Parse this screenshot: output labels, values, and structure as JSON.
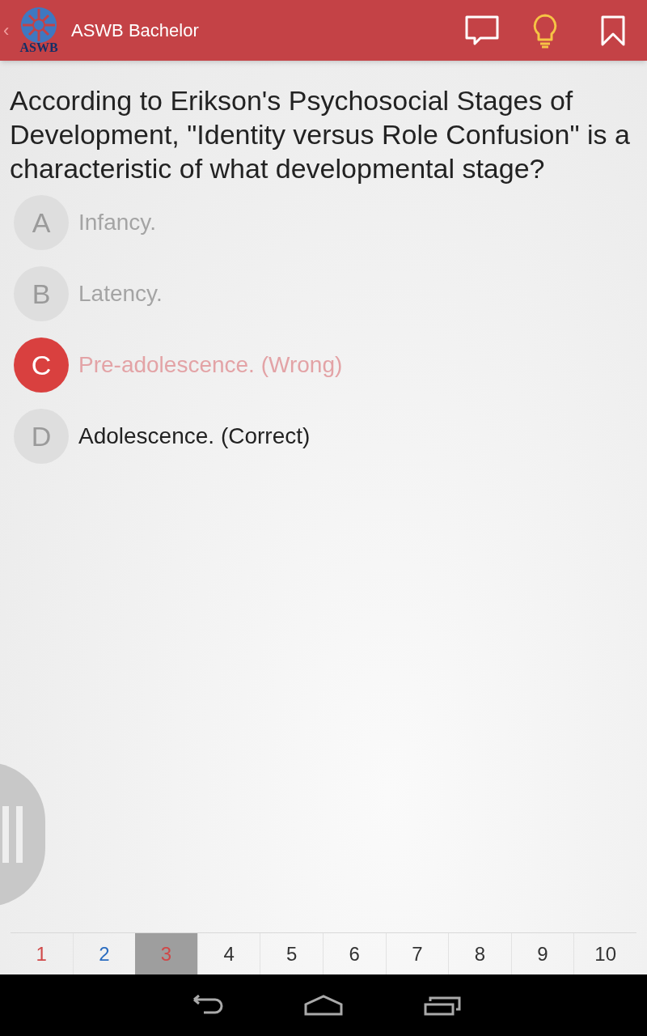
{
  "app_bar": {
    "back": "‹",
    "logo_text": "ASWB",
    "title": "ASWB Bachelor"
  },
  "question": "According to Erikson's Psychosocial Stages of Development, \"Identity versus Role Confusion\" is a characteristic of what developmental stage?",
  "options": [
    {
      "letter": "A",
      "text": "Infancy.",
      "kind": "plain"
    },
    {
      "letter": "B",
      "text": "Latency.",
      "kind": "plain"
    },
    {
      "letter": "C",
      "text": "Pre-adolescence. (Wrong)",
      "kind": "wrong"
    },
    {
      "letter": "D",
      "text": "Adolescence. (Correct)",
      "kind": "correct"
    }
  ],
  "pages": [
    {
      "label": "1",
      "kind": "wrong",
      "selected": false
    },
    {
      "label": "2",
      "kind": "correct",
      "selected": false
    },
    {
      "label": "3",
      "kind": "wrong",
      "selected": true
    },
    {
      "label": "4",
      "kind": "unanswered",
      "selected": false
    },
    {
      "label": "5",
      "kind": "unanswered",
      "selected": false
    },
    {
      "label": "6",
      "kind": "unanswered",
      "selected": false
    },
    {
      "label": "7",
      "kind": "unanswered",
      "selected": false
    },
    {
      "label": "8",
      "kind": "unanswered",
      "selected": false
    },
    {
      "label": "9",
      "kind": "unanswered",
      "selected": false
    },
    {
      "label": "10",
      "kind": "unanswered",
      "selected": false
    }
  ]
}
